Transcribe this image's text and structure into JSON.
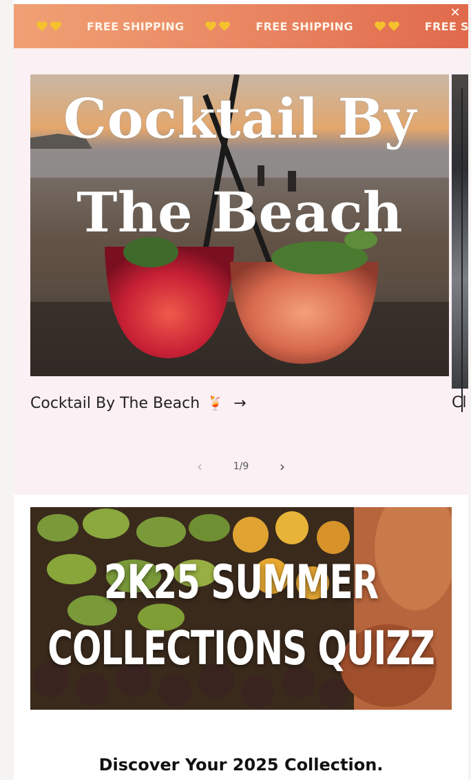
{
  "announcement": {
    "message": "FREE SHIPPING",
    "repeat_count": 3,
    "close_symbol": "✕",
    "heart_color": "#f5c22e",
    "gradient": [
      "#f0a074",
      "#e06a4c"
    ]
  },
  "slider": {
    "background": "#fbf0f4",
    "slide_title_line1": "Cocktail By",
    "slide_title_line2": "The Beach",
    "caption": "Cocktail By The Beach",
    "caption_emoji": "🍹",
    "caption_arrow": "→",
    "next_caption_partial": "Cl",
    "pager": {
      "prev": "‹",
      "count": "1/9",
      "next": "›"
    }
  },
  "quiz_banner": {
    "line1": "2K25 SUMMER",
    "line2": "COLLECTIONS QUIZZ"
  },
  "discover_heading": "Discover Your 2025 Collection."
}
